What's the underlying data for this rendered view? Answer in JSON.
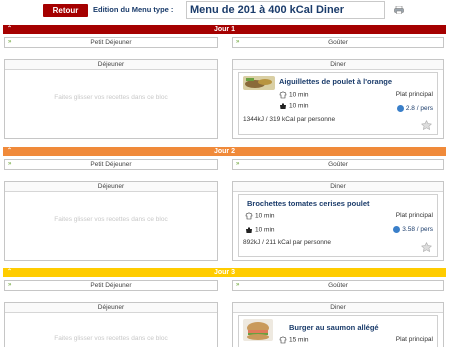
{
  "header": {
    "retour_label": "Retour",
    "edition_label": "Edition du Menu type :",
    "menu_name": "Menu de 201 à 400 kCal Diner"
  },
  "placeholder": "Faites glisser vos recettes dans ce bloc",
  "days": [
    {
      "label": "Jour 1",
      "color": "#a50000",
      "petit_dejeuner": "Petit Déjeuner",
      "gouter": "Goûter",
      "dejeuner": "Déjeuner",
      "diner": "Diner",
      "recipe": {
        "title": "Aiguillettes de poulet à l'orange",
        "prep_time": "10 min",
        "cook_time": "10 min",
        "category": "Plat principal",
        "price": "2.8 / pers",
        "kcal": "1344kJ / 319 kCal par personne"
      }
    },
    {
      "label": "Jour 2",
      "color": "#f08a3a",
      "petit_dejeuner": "Petit Déjeuner",
      "gouter": "Goûter",
      "dejeuner": "Déjeuner",
      "diner": "Diner",
      "recipe": {
        "title": "Brochettes tomates cerises poulet",
        "prep_time": "10 min",
        "cook_time": "10 min",
        "category": "Plat principal",
        "price": "3.58 / pers",
        "kcal": "892kJ / 211 kCal par personne"
      }
    },
    {
      "label": "Jour 3",
      "color": "#ffcc00",
      "petit_dejeuner": "Petit Déjeuner",
      "gouter": "Goûter",
      "dejeuner": "Déjeuner",
      "diner": "Diner",
      "recipe": {
        "title": "Burger au saumon allégé",
        "prep_time": "15 min",
        "category": "Plat principal"
      }
    }
  ],
  "colors": {
    "accent": "#a50000",
    "title_blue": "#1b3c6b",
    "chevron_green": "#5a9a1f",
    "price_coin": "#3a7fc9"
  },
  "icons": {
    "print": "printer-icon",
    "chevron": "double-chevron-icon",
    "chef": "chef-hat-icon",
    "pot": "cooking-pot-icon",
    "coin": "euro-coin-icon",
    "star": "favorite-star-icon"
  }
}
